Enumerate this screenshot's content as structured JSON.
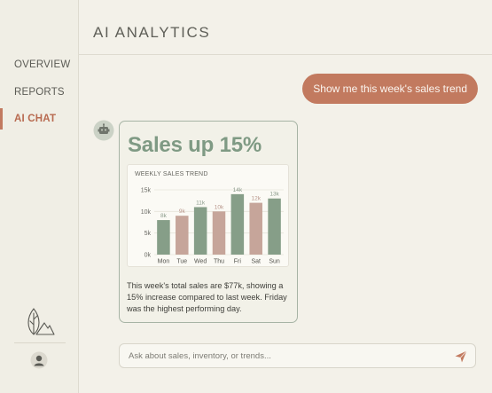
{
  "header": {
    "title": "AI ANALYTICS"
  },
  "sidebar": {
    "items": [
      {
        "label": "OVERVIEW",
        "active": false
      },
      {
        "label": "REPORTS",
        "active": false
      },
      {
        "label": "AI CHAT",
        "active": true
      }
    ],
    "logo_icon": "leaf-mountain-icon",
    "profile_icon": "user-avatar-icon"
  },
  "chat": {
    "user_message": "Show me this week's sales trend",
    "bot_icon": "robot-icon",
    "response": {
      "headline": "Sales up 15%",
      "chart_title": "WEEKLY SALES TREND",
      "summary": "This week's total sales are $77k, showing a 15% increase compared to last week. Friday was the highest performing day."
    },
    "input": {
      "placeholder": "Ask about sales, inventory, or trends...",
      "value": ""
    },
    "send_icon": "paper-plane-icon"
  },
  "colors": {
    "accent": "#c27a5f",
    "sage": "#7f9a84",
    "bar_green": "#869e88",
    "bar_rose": "#c6a59a",
    "background": "#f3f1e9"
  },
  "chart_data": {
    "type": "bar",
    "title": "WEEKLY SALES TREND",
    "categories": [
      "Mon",
      "Tue",
      "Wed",
      "Thu",
      "Fri",
      "Sat",
      "Sun"
    ],
    "values": [
      8,
      9,
      11,
      10,
      14,
      12,
      13
    ],
    "labels": [
      "8k",
      "9k",
      "11k",
      "10k",
      "14k",
      "12k",
      "13k"
    ],
    "bar_colors": [
      "green",
      "rose",
      "green",
      "rose",
      "green",
      "rose",
      "green"
    ],
    "yticks": [
      "0k",
      "5k",
      "10k",
      "15k"
    ],
    "ytick_values": [
      0,
      5,
      10,
      15
    ],
    "ylim": [
      0,
      15
    ],
    "grid": true
  }
}
